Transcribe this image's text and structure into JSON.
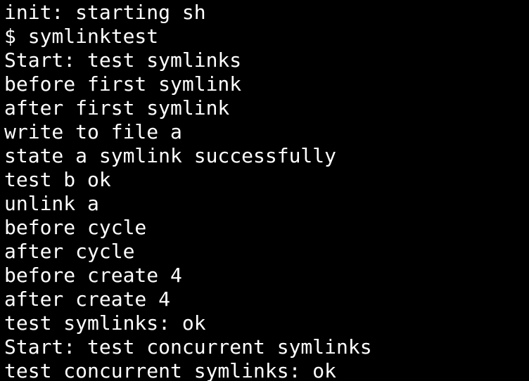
{
  "terminal": {
    "lines": [
      "init: starting sh",
      "$ symlinktest",
      "Start: test symlinks",
      "before first symlink",
      "after first symlink",
      "write to file a",
      "state a symlink successfully",
      "test b ok",
      "unlink a",
      "before cycle",
      "after cycle",
      "before create 4",
      "after create 4",
      "test symlinks: ok",
      "Start: test concurrent symlinks",
      "test concurrent symlinks: ok"
    ]
  },
  "colors": {
    "background": "#000000",
    "foreground": "#ffffff"
  }
}
